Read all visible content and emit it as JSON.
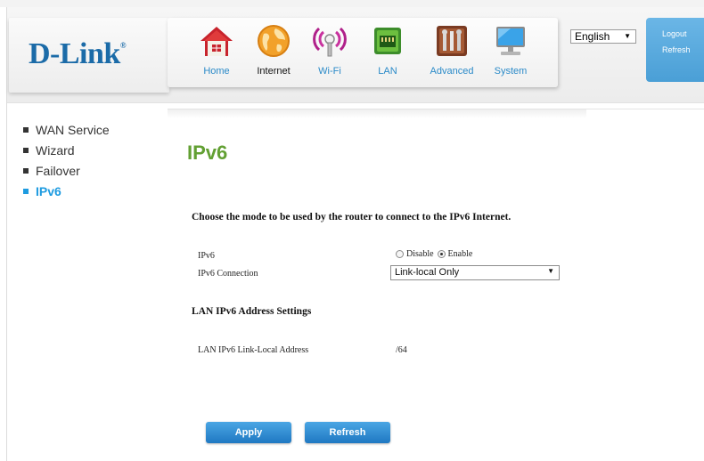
{
  "brand": {
    "logo": "D-Link",
    "registered": "®"
  },
  "nav": [
    {
      "label": "Home",
      "icon": "home-icon",
      "active": false
    },
    {
      "label": "Internet",
      "icon": "globe-icon",
      "active": true
    },
    {
      "label": "Wi-Fi",
      "icon": "wifi-icon",
      "active": false
    },
    {
      "label": "LAN",
      "icon": "lan-icon",
      "active": false
    },
    {
      "label": "Advanced",
      "icon": "tools-icon",
      "active": false
    },
    {
      "label": "System",
      "icon": "monitor-icon",
      "active": false
    }
  ],
  "language": {
    "selected": "English"
  },
  "side_panel": {
    "logout": "Logout",
    "refresh": "Refresh"
  },
  "sidebar": [
    {
      "label": "WAN Service",
      "active": false
    },
    {
      "label": "Wizard",
      "active": false
    },
    {
      "label": "Failover",
      "active": false
    },
    {
      "label": "IPv6",
      "active": true
    }
  ],
  "page": {
    "title": "IPv6",
    "instruction": "Choose the mode to be used by the router to connect to the IPv6 Internet.",
    "ipv6_label": "IPv6",
    "disable_label": "Disable",
    "enable_label": "Enable",
    "ipv6_state": "Enable",
    "connection_label": "IPv6 Connection",
    "connection_value": "Link-local Only",
    "lan_section": "LAN IPv6 Address Settings",
    "link_local_label": "LAN IPv6 Link-Local Address",
    "link_local_value": "/64"
  },
  "buttons": {
    "apply": "Apply",
    "refresh": "Refresh"
  },
  "colors": {
    "accent_blue": "#1e9be0",
    "title_green": "#62a033",
    "logo_blue": "#1b6ba8"
  }
}
